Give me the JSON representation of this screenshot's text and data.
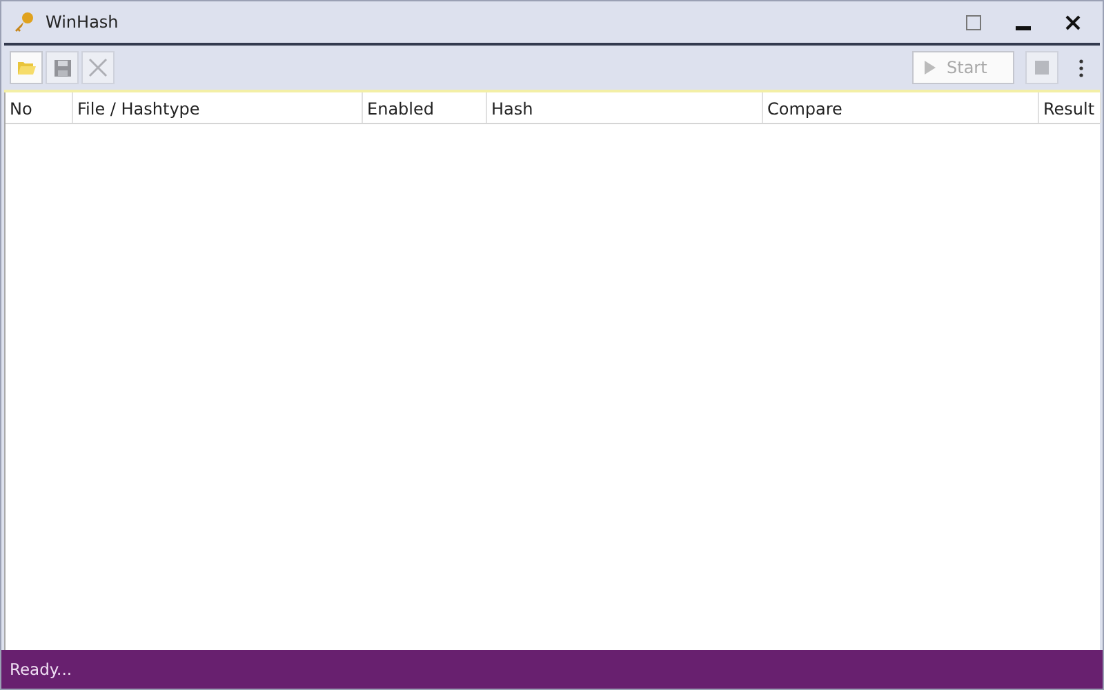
{
  "window": {
    "title": "WinHash"
  },
  "toolbar": {
    "left": [
      {
        "kind": "open",
        "disabled": false
      },
      {
        "kind": "save",
        "disabled": true
      },
      {
        "kind": "clear",
        "disabled": true
      }
    ],
    "start": {
      "label": "Start",
      "disabled": true
    },
    "stop": {
      "disabled": true
    }
  },
  "table": {
    "columns": [
      "No",
      "File / Hashtype",
      "Enabled",
      "Hash",
      "Compare",
      "Result"
    ]
  },
  "status_bar": "Ready..."
}
